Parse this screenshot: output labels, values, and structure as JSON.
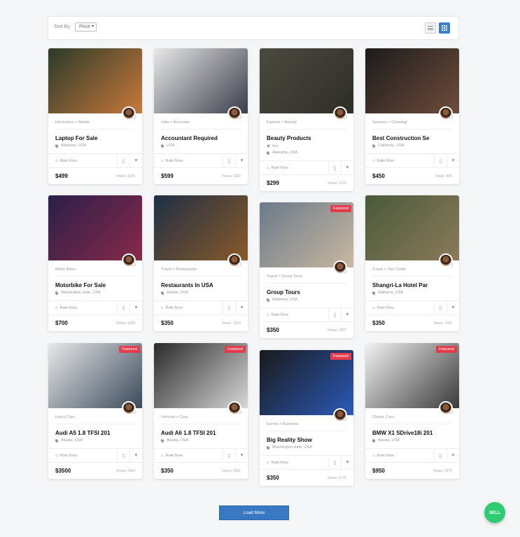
{
  "toolbar": {
    "sort_label": "Sort By:",
    "sort_value": "Price",
    "list_view_icon": "list-icon",
    "grid_view_icon": "grid-icon"
  },
  "listings": [
    {
      "category": "Electronics > Mobile",
      "title": "Laptop For Sale",
      "location": "Alabama, USA",
      "rate": "Rate Now",
      "price": "$499",
      "views": "Views: 1035",
      "photo": [
        "#2a3b2a",
        "#c9783a"
      ]
    },
    {
      "category": "Jobs > Accounts",
      "title": "Accountant Required",
      "location": "USA",
      "rate": "Rate Now",
      "price": "$599",
      "views": "Views: 1020",
      "photo": [
        "#e8e8e8",
        "#3a3f4a"
      ]
    },
    {
      "category": "Fashion > Beauty",
      "title": "Beauty Products",
      "extra": "Yes",
      "location": "Alabama, USA",
      "rate": "Rate Now",
      "price": "$299",
      "views": "Views: 1105",
      "photo": [
        "#4a4a40",
        "#2e2e28"
      ]
    },
    {
      "category": "Services > Cleaning",
      "title": "Best Construction Se",
      "location": "California, USA",
      "rate": "Rate Now",
      "price": "$450",
      "views": "Views: 496",
      "photo": [
        "#1c1c1c",
        "#6e4c3a"
      ]
    },
    {
      "category": "Motor Bikes",
      "title": "Motorbike For Sale",
      "location": "Washington state, USA",
      "rate": "Rate Now",
      "price": "$700",
      "views": "Views: 1299",
      "photo": [
        "#2a1f4a",
        "#8a2a4a"
      ]
    },
    {
      "category": "Travel > Restaurants",
      "title": "Restaurants In USA",
      "location": "Alaska, USA",
      "rate": "Rate Now",
      "price": "$350",
      "views": "Views: 1010",
      "photo": [
        "#1e2f44",
        "#8a5a2a"
      ]
    },
    {
      "category": "Travel > Group Tours",
      "title": "Group Tours",
      "location": "Alabama, USA",
      "rate": "Rate Now",
      "price": "$350",
      "views": "Views: 2207",
      "featured": "Featured",
      "photo": [
        "#6a7a8a",
        "#c9b8a0"
      ]
    },
    {
      "category": "Travel > Tour Guide",
      "title": "Shangri-La Hotel Par",
      "location": "Alabama, USA",
      "rate": "Rate Now",
      "price": "$350",
      "views": "Views: 1156",
      "photo": [
        "#4a5a3a",
        "#8a7a5a"
      ]
    },
    {
      "category": "Fancy Cars",
      "title": "Audi A5 1.8 TFSI 201",
      "location": "Alaska, USA",
      "rate": "Rate Now",
      "price": "$3500",
      "views": "Views: 2660",
      "featured": "Featured",
      "photo": [
        "#e8e8ea",
        "#3a4a5a"
      ]
    },
    {
      "category": "Vehicles > Cars",
      "title": "Audi A6 1.8 TFSI 201",
      "location": "Alaska, USA",
      "rate": "Rate Now",
      "price": "$350",
      "views": "Views: 2541",
      "featured": "Featured",
      "photo": [
        "#2a2a2a",
        "#d8d8d8"
      ]
    },
    {
      "category": "Events > Business",
      "title": "Big Reality Show",
      "location": "Washington state, USA",
      "rate": "Rate Now",
      "price": "$350",
      "views": "Views: 2175",
      "featured": "Featured",
      "photo": [
        "#1a1a1a",
        "#2a5ab8"
      ]
    },
    {
      "category": "Classic Cars",
      "title": "BMW X1 SDrive18i 201",
      "location": "Alaska, USA",
      "rate": "Rate Now",
      "price": "$950",
      "views": "Views: 3370",
      "featured": "Featured",
      "photo": [
        "#f2f2f2",
        "#3a3a3a"
      ]
    }
  ],
  "load_more": "Load More",
  "sell": "SELL"
}
